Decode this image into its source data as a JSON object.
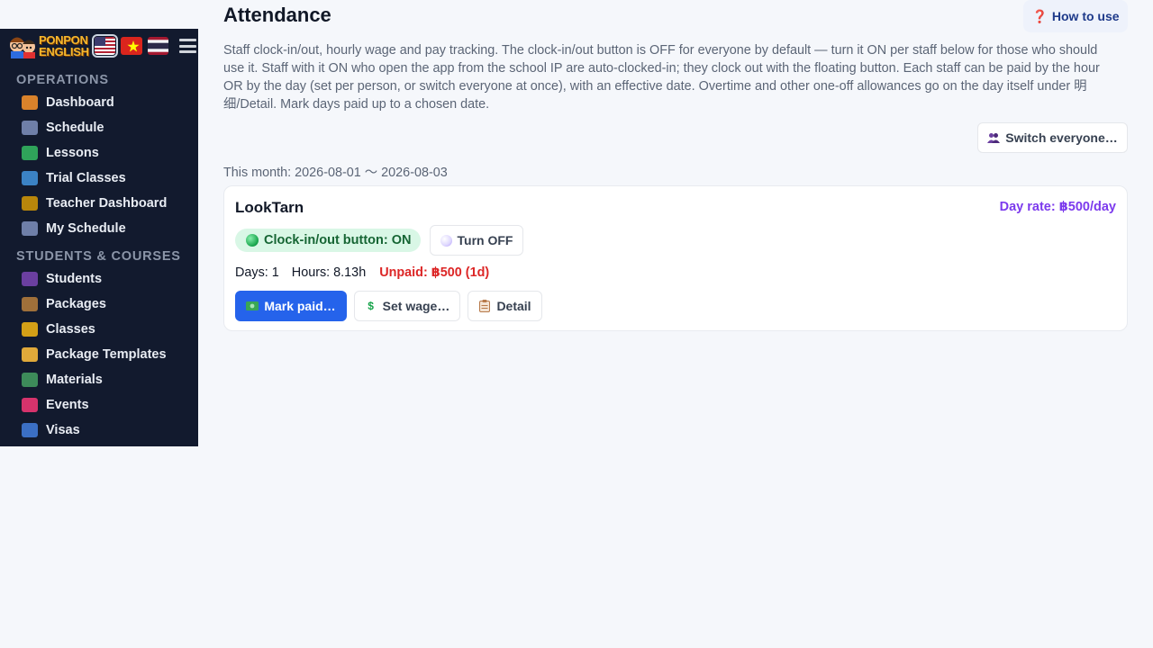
{
  "brand": {
    "line1": "PONPON",
    "line2": "ENGLISH"
  },
  "languages": [
    {
      "name": "us-flag-icon",
      "active": true
    },
    {
      "name": "vn-flag-icon",
      "active": false
    },
    {
      "name": "th-flag-icon",
      "active": false
    }
  ],
  "sidebar": {
    "operations_title": "OPERATIONS",
    "operations": [
      {
        "label": "Dashboard",
        "icon": "house-icon"
      },
      {
        "label": "Schedule",
        "icon": "calendar-icon"
      },
      {
        "label": "Lessons",
        "icon": "check-icon"
      },
      {
        "label": "Trial Classes",
        "icon": "magnifier-icon"
      },
      {
        "label": "Teacher Dashboard",
        "icon": "teacher-icon"
      },
      {
        "label": "My Schedule",
        "icon": "calendar-icon"
      }
    ],
    "students_title": "STUDENTS & COURSES",
    "students": [
      {
        "label": "Students",
        "icon": "people-icon"
      },
      {
        "label": "Packages",
        "icon": "package-icon"
      },
      {
        "label": "Classes",
        "icon": "group-icon"
      },
      {
        "label": "Package Templates",
        "icon": "folder-icon"
      },
      {
        "label": "Materials",
        "icon": "books-icon"
      },
      {
        "label": "Events",
        "icon": "ticket-icon"
      },
      {
        "label": "Visas",
        "icon": "passport-icon"
      }
    ]
  },
  "header": {
    "title": "Attendance",
    "how_to_use": "How to use"
  },
  "description": "Staff clock-in/out, hourly wage and pay tracking. The clock-in/out button is OFF for everyone by default — turn it ON per staff below for those who should use it. Staff with it ON who open the app from the school IP are auto-clocked-in; they clock out with the floating button. Each staff can be paid by the hour OR by the day (set per person, or switch everyone at once), with an effective date. Overtime and other one-off allowances go on the day itself under 明细/Detail. Mark days paid up to a chosen date.",
  "switch_everyone": "Switch everyone…",
  "month_range": "This month: 2026-08-01 〜 2026-08-03",
  "staff": {
    "name": "LookTarn",
    "day_rate": "Day rate: ฿500/day",
    "clock_status": "Clock-in/out button: ON",
    "turn_off": "Turn OFF",
    "days": "Days: 1",
    "hours": "Hours: 8.13h",
    "unpaid": "Unpaid: ฿500 (1d)",
    "mark_paid": "Mark paid…",
    "set_wage": "Set wage…",
    "detail": "Detail"
  },
  "colors": {
    "sidebar_bg": "#121a2e",
    "primary": "#2563eb",
    "unpaid": "#dc2626",
    "rate": "#7c3aed",
    "on_pill": "#d9f7e6"
  }
}
